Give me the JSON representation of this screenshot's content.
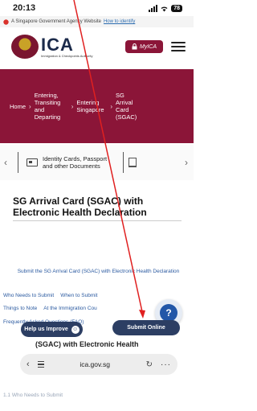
{
  "status_bar": {
    "time": "20:13",
    "signal_icon": "signal-bars-icon",
    "wifi_icon": "wifi-icon",
    "battery_level": "78"
  },
  "gov_banner": {
    "text": "A Singapore Government Agency Website",
    "link": "How to identify"
  },
  "header": {
    "logo_text": "ICA",
    "logo_subtext": "Immigration & Checkpoints Authority",
    "myica_label": "MyICA"
  },
  "breadcrumb": {
    "items": [
      "Home",
      "Entering, Transiting and Departing",
      "Entering Singapore",
      "SG Arrival Card (SGAC)"
    ]
  },
  "carousel": {
    "label": "Identity Cards, Passport and other Documents"
  },
  "page": {
    "title": "SG Arrival Card (SGAC) with Electronic Health Declaration",
    "toc": [
      "Submit the SG Arrival Card (SGAC) with Electronic Health Declaration",
      "Who Needs to Submit",
      "When to Submit",
      "Things to Note",
      "At the Immigration Cou",
      "Frequently Asked Questions (FAQ)"
    ],
    "sub_heading": "(SGAC) with Electronic Health",
    "faded_link": "1.1 Who Needs to Submit"
  },
  "buttons": {
    "help_label": "Help us Improve",
    "submit_label": "Submit Online"
  },
  "browser": {
    "url": "ica.gov.sg"
  },
  "colors": {
    "brand": "#8b1538",
    "navy": "#2c3e63",
    "link": "#2b5aa0"
  }
}
